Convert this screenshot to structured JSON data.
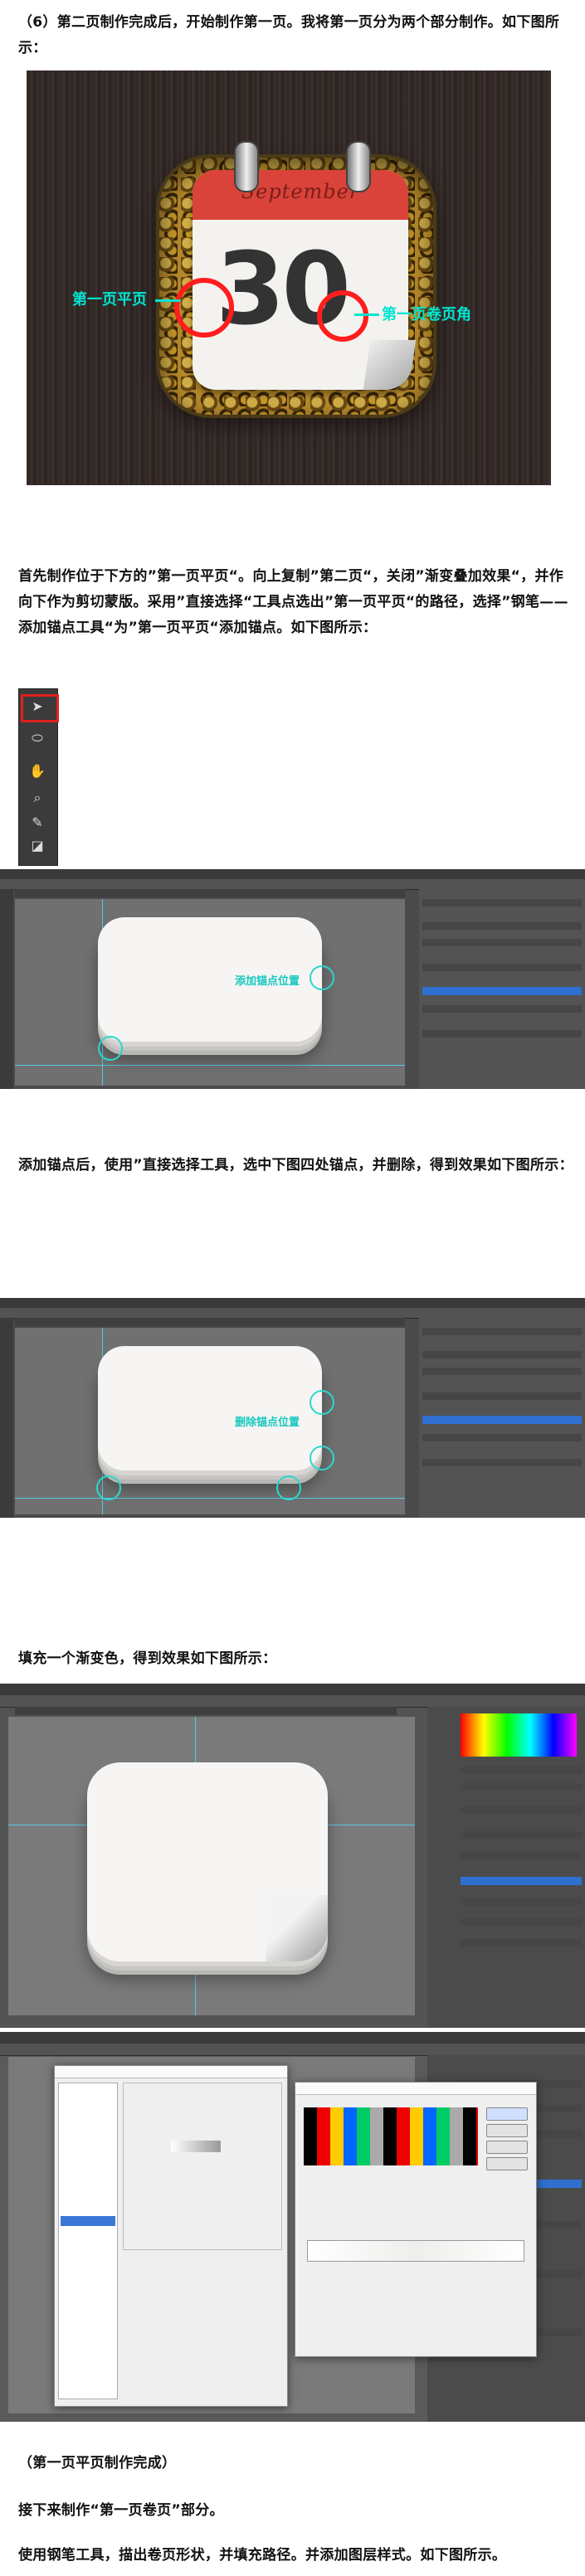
{
  "paragraphs": {
    "p1": "（6）第二页制作完成后，开始制作第一页。我将第一页分为两个部分制作。如下图所示：",
    "p2": "首先制作位于下方的”第一页平页“。向上复制”第二页“，关闭”渐变叠加效果“，并作向下作为剪切蒙版。采用”直接选择“工具点选出”第一页平页“的路径，选择”钢笔——添加锚点工具“为”第一页平页“添加锚点。如下图所示：",
    "p3": "添加锚点后，使用”直接选择工具，选中下图四处锚点，并删除，得到效果如下图所示：",
    "p4": "填充一个渐变色，得到效果如下图所示：",
    "p5": "（第一页平页制作完成）",
    "p6": "接下来制作“第一页卷页”部分。",
    "p7": "使用钢笔工具，描出卷页形状，并填充路径。并添加图层样式。如下图所示。"
  },
  "hero": {
    "month": "September",
    "day": "30",
    "label_flat": "第一页平页",
    "label_curl": "第一页卷页角"
  },
  "ps1": {
    "annotation": "添加锚点位置"
  },
  "ps2": {
    "annotation": "删除锚点位置"
  },
  "colors": {
    "accent_cyan": "#00e5d0",
    "highlight_red": "#ff1d1d",
    "calendar_red": "#d9433a"
  }
}
